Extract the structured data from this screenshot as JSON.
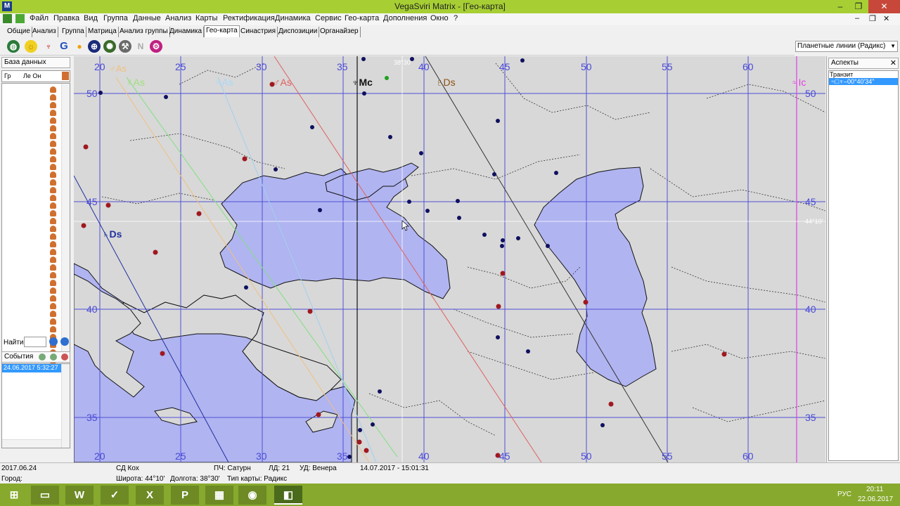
{
  "window": {
    "title": "VegaSviri Matrix - [Гео-карта]",
    "app_icon": "M",
    "minimize": "–",
    "restore": "❐",
    "close": "✕"
  },
  "menu": {
    "items": [
      "Файл",
      "Правка",
      "Вид",
      "Группа",
      "Данные",
      "Анализ",
      "Карты",
      "Ректификация",
      "Динамика",
      "Сервис",
      "Гео-карта",
      "Дополнения",
      "Окно",
      "?"
    ],
    "right_buttons": [
      "–",
      "❐",
      "✕"
    ]
  },
  "tabs": {
    "items": [
      "Общие",
      "Анализ",
      "Группа",
      "Матрица",
      "Анализ группы",
      "Динамика",
      "Гео-карта",
      "Синастрия",
      "Диспозиции",
      "Органайзер"
    ],
    "active": "Гео-карта"
  },
  "toolbar": {
    "icons": [
      "globe-icon",
      "sun-icon",
      "cross-planet-icon",
      "g-letter-icon",
      "moon-dot-icon",
      "earth-sign-icon",
      "gear-planet-icon",
      "tool-icon",
      "n-icon",
      "stamp-icon"
    ],
    "g_label": "G",
    "n_label": "N",
    "earth_label": "⊕",
    "moon_label": "●",
    "cross_label": "♆",
    "stamp_label": "⚙"
  },
  "planet_lines_select": {
    "value": "Планетные линии (Радикс)"
  },
  "left": {
    "db_tab": "База данных",
    "group_header": "Гр",
    "cols_header": "Ле  Он",
    "find_label": "Найти",
    "events_label": "События",
    "event_item": "24.06.2017 5:32:27"
  },
  "right": {
    "title": "Аспекты",
    "transit_label": "Транзит",
    "aspect_item": "♃□♆–00°40'34\""
  },
  "map": {
    "lon_labels": [
      "20",
      "25",
      "30",
      "35",
      "40",
      "45",
      "50",
      "55",
      "60"
    ],
    "lat_labels": [
      "50",
      "45",
      "40",
      "35"
    ],
    "line_labels": {
      "sa": "♂As",
      "me_as": "☿As",
      "ju_as": "♃As",
      "ma_as": "♂As",
      "ne_mc": "♆Mc",
      "pl_ds": "♇Ds",
      "ju_ic": "♃Ic",
      "sa_ds": "♄Ds"
    },
    "cursor_lat": "44°10'",
    "cursor_lon": "38°30'"
  },
  "status": {
    "date": "2017.06.24",
    "sd": "СД Кох",
    "pch": "ПЧ: Сатурн",
    "ld": "ЛД: 21",
    "ud": "УД: Венера",
    "transit_dt": "14.07.2017 - 15:01:31",
    "city_label": "Город:",
    "lat": "Широта: 44°10'",
    "lon": "Долгота: 38°30'",
    "type": "Тип карты: Радикс"
  },
  "taskbar": {
    "lang": "РУС",
    "time": "20:11",
    "date": "22.06.2017",
    "apps": [
      "explorer-icon",
      "word-icon",
      "vega-icon",
      "excel-icon",
      "powerpoint-icon",
      "chrome-icon",
      "calc-icon",
      "matrix-icon"
    ]
  },
  "colors": {
    "water": "#b0b4f0",
    "land": "#d8d8d8",
    "grid": "#5050d8",
    "title": "#a7cf34",
    "taskbar": "#87a92d",
    "red_dot": "#a01820",
    "blue_dot": "#101060"
  }
}
